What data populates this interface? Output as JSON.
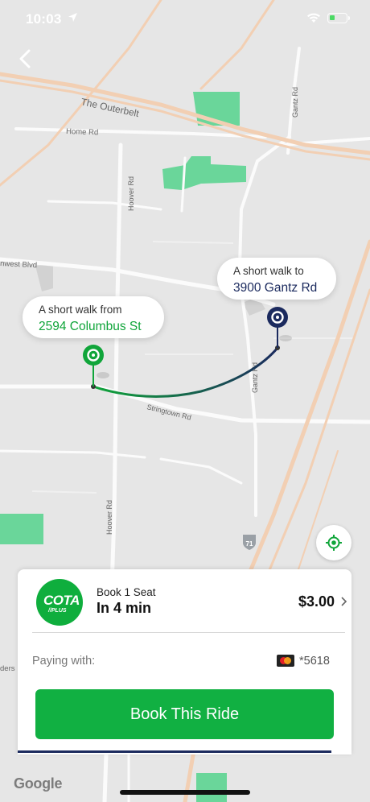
{
  "status_bar": {
    "time": "10:03"
  },
  "map": {
    "roads": {
      "outerbelt": "The Outerbelt",
      "home_rd": "Home Rd",
      "hoover_rd_north": "Hoover Rd",
      "hoover_rd_south": "Hoover Rd",
      "gantz_rd_north": "Gantz Rd",
      "gantz_rd": "Gantz Rd",
      "stringtown_rd": "Stringtown Rd",
      "westward_blvd": "nwest Blvd",
      "interstate": "71",
      "side_road": "ders"
    },
    "pickup": {
      "label": "A short walk from",
      "address": "2594 Columbus St",
      "color": "#10a53a"
    },
    "dropoff": {
      "label": "A short walk to",
      "address": "3900 Gantz Rd",
      "color": "#1b2a5e"
    }
  },
  "sheet": {
    "logo": {
      "name": "COTA",
      "sub": "//PLUS",
      "color": "#0fae3d"
    },
    "ride_title": "Book 1 Seat",
    "ride_eta": "In 4 min",
    "price": "$3.00",
    "payment_label": "Paying with:",
    "card_last4": "*5618",
    "book_button_label": "Book This Ride",
    "accent_color": "#11b042"
  },
  "branding": {
    "google": "Google"
  },
  "icons": [
    "location-arrow-icon",
    "wifi-icon",
    "battery-icon",
    "back-chevron-icon",
    "pickup-pin-icon",
    "dropoff-pin-icon",
    "locate-me-icon",
    "chevron-right-icon",
    "mastercard-icon"
  ]
}
